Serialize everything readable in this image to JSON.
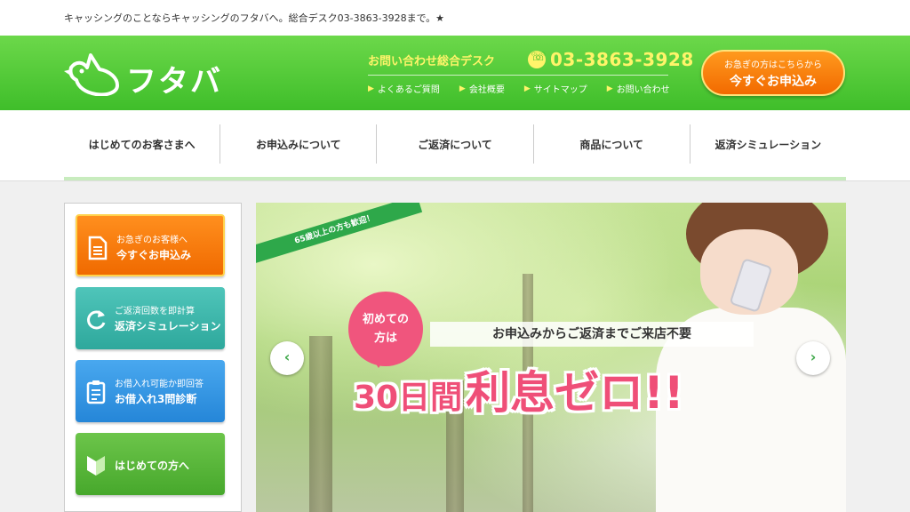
{
  "topbar": {
    "tagline": "キャッシングのことならキャッシングのフタバへ。総合デスク03-3863-3928まで。★"
  },
  "header": {
    "logo_text": "フタバ",
    "contact_label": "お問い合わせ総合デスク",
    "phone": "03-3863-3928",
    "links": [
      "よくあるご質問",
      "会社概要",
      "サイトマップ",
      "お問い合わせ"
    ],
    "cta_small": "お急ぎの方はこちらから",
    "cta_big": "今すぐお申込み"
  },
  "nav": {
    "items": [
      "はじめてのお客さまへ",
      "お申込みについて",
      "ご返済について",
      "商品について",
      "返済シミュレーション"
    ]
  },
  "side": {
    "apply": {
      "line1": "お急ぎのお客様へ",
      "line2": "今すぐお申込み"
    },
    "simulate": {
      "line1": "ご返済回数を即計算",
      "line2": "返済シミュレーション"
    },
    "diagnose": {
      "line1": "お借入れ可能か即回答",
      "line2": "お借入れ3問診断"
    },
    "beginner": {
      "label": "はじめての方へ"
    }
  },
  "hero": {
    "ribbon": "65歳以上の方も歓迎！",
    "bubble_line1": "初めての",
    "bubble_line2": "方は",
    "subhead": "お申込みからご返済までご来店不要",
    "headline_a": "30日間",
    "headline_b": "利息ゼロ!!",
    "prev": "‹",
    "next": "›"
  },
  "colors": {
    "header_green": "#3fbe2a",
    "accent_yellow": "#fff46a",
    "cta_orange": "#f26a00",
    "pink": "#ef4f78"
  }
}
